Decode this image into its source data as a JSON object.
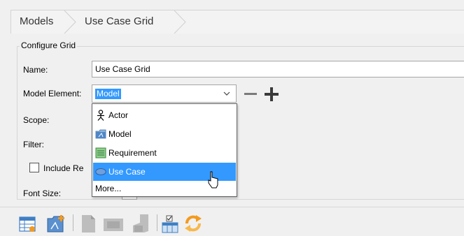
{
  "breadcrumb": {
    "items": [
      "Models",
      "Use Case Grid"
    ]
  },
  "group": {
    "title": "Configure Grid"
  },
  "form": {
    "name_label": "Name:",
    "name_value": "Use Case Grid",
    "model_element_label": "Model Element:",
    "model_element_value": "Model",
    "scope_label": "Scope:",
    "filter_label": "Filter:",
    "include_label": "Include Re",
    "font_size_label": "Font Size:"
  },
  "dropdown": {
    "options": [
      {
        "label": "Actor",
        "icon": "actor-icon"
      },
      {
        "label": "Model",
        "icon": "model-icon"
      },
      {
        "label": "Requirement",
        "icon": "requirement-icon"
      },
      {
        "label": "Use Case",
        "icon": "use-case-icon",
        "selected": true
      },
      {
        "label": "More...",
        "icon": ""
      }
    ]
  },
  "colors": {
    "selection": "#3399ff",
    "accent_orange": "#f39a1e",
    "icon_blue": "#3f7fc4"
  },
  "toolbar": {
    "icons": [
      "grid-view-icon",
      "model-tree-icon",
      "document-icon",
      "box-icon",
      "lock-icon",
      "table-filter-icon",
      "refresh-icon"
    ]
  }
}
